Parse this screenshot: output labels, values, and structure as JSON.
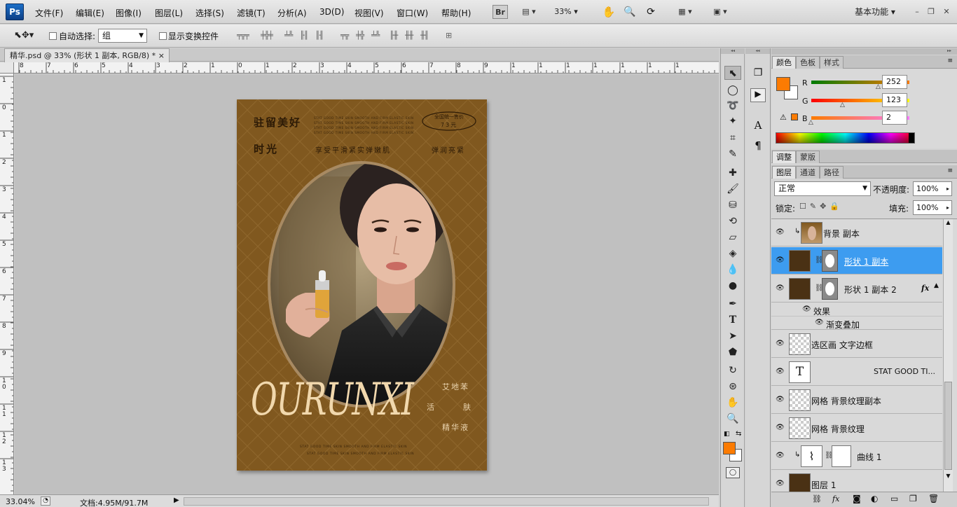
{
  "app": {
    "logo": "Ps"
  },
  "menu": [
    "文件(F)",
    "编辑(E)",
    "图像(I)",
    "图层(L)",
    "选择(S)",
    "滤镜(T)",
    "分析(A)",
    "3D(D)",
    "视图(V)",
    "窗口(W)",
    "帮助(H)"
  ],
  "menubar_right": {
    "bridge": "Br",
    "zoom": "33%",
    "workspace": "基本功能"
  },
  "options": {
    "auto_select_label": "自动选择:",
    "auto_select_value": "组",
    "show_transform_label": "显示变换控件"
  },
  "document": {
    "tab_title": "精华.psd @ 33% (形状 1 副本, RGB/8) *",
    "tab_close": "×",
    "ruler_top_labels": [
      "8",
      "7",
      "6",
      "5",
      "4",
      "3",
      "2",
      "1",
      "0",
      "1",
      "2",
      "3",
      "4",
      "5",
      "6",
      "7",
      "8",
      "9",
      "1",
      "1",
      "1",
      "1",
      "1",
      "1",
      "1"
    ],
    "ruler_left_labels": [
      "1",
      "0",
      "1",
      "2",
      "3",
      "4",
      "5",
      "6",
      "7",
      "8",
      "9",
      "1 0",
      "1 1",
      "1 2",
      "1 3"
    ],
    "zoom_status": "33.04%",
    "doc_status": "文档:4.95M/91.7M"
  },
  "poster": {
    "title_line1": "驻留美好",
    "title_line2": "时光",
    "slogan_small": "STAT GOOD TIME SKIN SMOOTH AND FIRM ELASTIC SKIN",
    "badge_line1": "全国统一售价",
    "badge_line2": "73元",
    "subtitle": "享受平滑紧实弹嫩肌",
    "subtitle_right": "弹润亮紧",
    "brand": "OURUNXI",
    "side_1": "艾地苯",
    "side_2a": "活",
    "side_2b": "肤",
    "side_3": "精华液",
    "footer_1": "STAT GOOD TIME SKIN SMOOTH AND FIRM ELASTIC SKIN",
    "footer_2": "STAT GOOD TIME SKIN SMOOTH AND FIRM ELASTIC SKIN",
    "colors": {
      "background": "#80581f",
      "dark_text": "#2c1a06",
      "light_text": "#ebd5b0"
    }
  },
  "color_panel": {
    "tabs": [
      "颜色",
      "色板",
      "样式"
    ],
    "r_label": "R",
    "r_value": "252",
    "g_label": "G",
    "g_value": "123",
    "b_label": "B",
    "b_value": "2",
    "foreground": "#fc7b02"
  },
  "adjust_tabs": [
    "调整",
    "蒙版"
  ],
  "layers_panel": {
    "tabs": [
      "图层",
      "通道",
      "路径"
    ],
    "blend_mode": "正常",
    "opacity_label": "不透明度:",
    "opacity_value": "100%",
    "lock_label": "锁定:",
    "fill_label": "填充:",
    "fill_value": "100%",
    "layers": [
      {
        "name": "背景 副本"
      },
      {
        "name": "形状 1 副本"
      },
      {
        "name": "形状 1 副本 2",
        "fx": "fx"
      },
      {
        "name": "效果"
      },
      {
        "name": "渐变叠加"
      },
      {
        "name": "选区画   文字边框"
      },
      {
        "name": "STAT GOOD TI...",
        "thumb_text": "T"
      },
      {
        "name": "网格   背景纹理副本"
      },
      {
        "name": "网格   背景纹理"
      },
      {
        "name": "曲线 1"
      },
      {
        "name": "图层 1"
      }
    ]
  }
}
